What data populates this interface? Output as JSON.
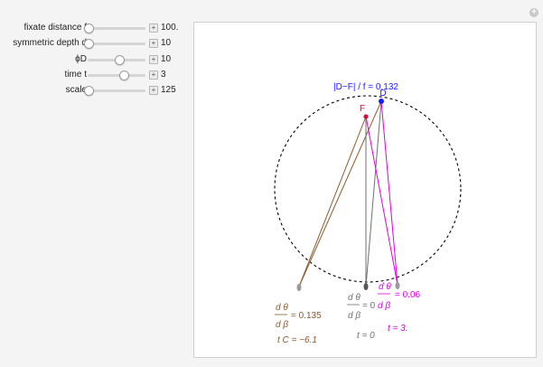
{
  "controls": [
    {
      "label": "fixate distance f",
      "value": "100.",
      "level": 0.02
    },
    {
      "label": "symmetric depth d",
      "value": "10",
      "level": 0.02
    },
    {
      "label": "ϕD",
      "value": "10",
      "level": 0.55
    },
    {
      "label": "time t",
      "value": "3",
      "level": 0.62
    },
    {
      "label": "scale",
      "value": "125",
      "level": 0.02
    }
  ],
  "toolbar": {
    "plus_symbol": "+",
    "reset_symbol": "+"
  },
  "plot": {
    "ratio_text": "|D−F| / f = 0.132",
    "label_D": "D",
    "label_F": "F",
    "theta_label": "d θ",
    "beta_label": "d β",
    "brown_value": "= 0.135",
    "brown_tc": "t C = −6.1",
    "gray_value": "= 0",
    "gray_t": "t = 0",
    "magenta_value": "= 0.06",
    "magenta_t": "t = 3."
  },
  "colors": {
    "brown": "#8b5a2b",
    "magenta": "#e000e0",
    "gray": "#707070",
    "blue": "#1a1aff",
    "red": "#e0003a"
  }
}
